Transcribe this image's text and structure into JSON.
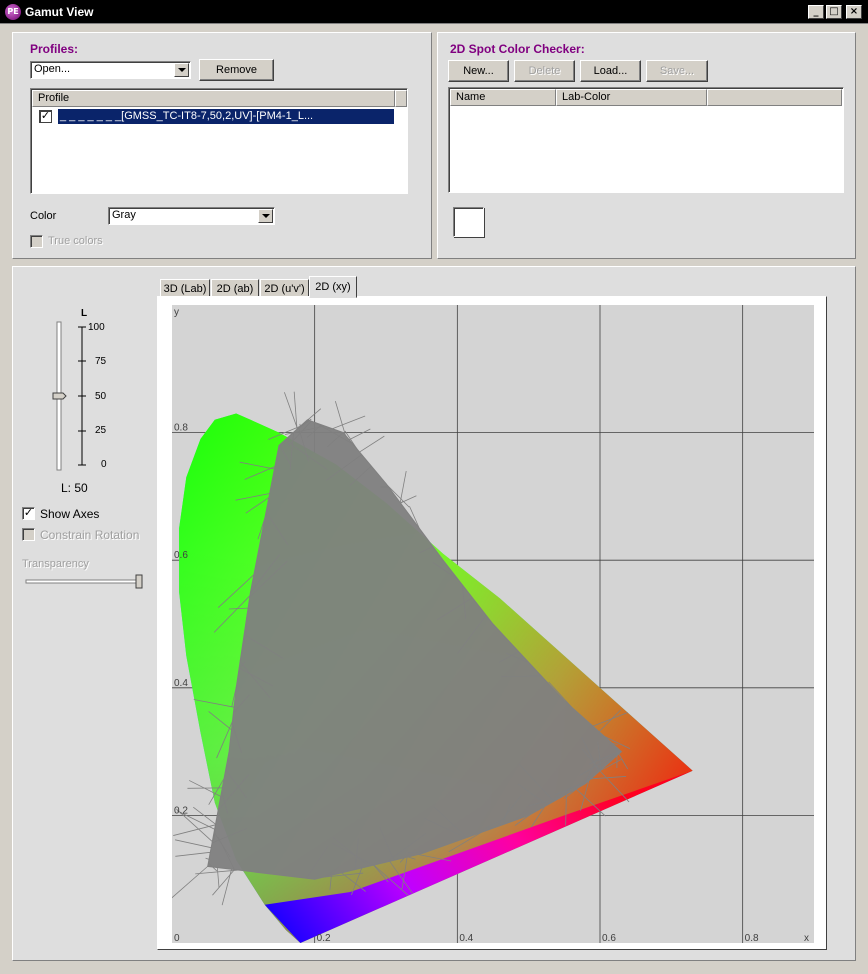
{
  "window": {
    "title": "Gamut View",
    "icon_text": "PE",
    "controls": {
      "minimize": "_",
      "maximize": "□",
      "close": "×"
    }
  },
  "profiles": {
    "title": "Profiles:",
    "open_combo": "Open...",
    "remove_label": "Remove",
    "list_header": "Profile",
    "items": [
      {
        "label": "_ _ _ _ _ _ _[GMSS_TC-IT8-7,50,2,UV]-[PM4-1_L...",
        "checked": true
      }
    ],
    "color_label": "Color",
    "color_value": "Gray",
    "true_colors_label": "True colors"
  },
  "spot_checker": {
    "title": "2D Spot Color Checker:",
    "new_label": "New...",
    "delete_label": "Delete",
    "load_label": "Load...",
    "save_label": "Save...",
    "columns": [
      "Name",
      "Lab-Color"
    ],
    "swatch_color": "#ffffff"
  },
  "controls": {
    "l_axis_label": "L",
    "l_ticks": [
      "100",
      "75",
      "50",
      "25",
      "0"
    ],
    "l_value": 50,
    "l_readout": "L: 50",
    "show_axes_label": "Show Axes",
    "show_axes_checked": true,
    "constrain_rotation_label": "Constrain Rotation",
    "transparency_label": "Transparency",
    "transparency_value": 1.0
  },
  "tabs": [
    {
      "label": "3D (Lab)",
      "active": false
    },
    {
      "label": "2D (ab)",
      "active": false
    },
    {
      "label": "2D (u'v')",
      "active": false
    },
    {
      "label": "2D (xy)",
      "active": true
    }
  ],
  "chart_data": {
    "type": "scatter",
    "title": "",
    "xlabel": "x",
    "ylabel": "y",
    "xlim": [
      0,
      0.9
    ],
    "ylim": [
      0,
      1.0
    ],
    "grid": true,
    "x_ticks": [
      "0",
      "0.2",
      "0.4",
      "0.6",
      "0.8"
    ],
    "y_ticks": [
      "0.2",
      "0.4",
      "0.6",
      "0.8"
    ],
    "origin_label": "0",
    "background_color": "#d4d4d4",
    "grid_color": "#404040",
    "gamut_color": "#808080",
    "spectral_locus": [
      [
        0.18,
        0.0
      ],
      [
        0.16,
        0.02
      ],
      [
        0.13,
        0.06
      ],
      [
        0.09,
        0.13
      ],
      [
        0.06,
        0.22
      ],
      [
        0.04,
        0.33
      ],
      [
        0.02,
        0.45
      ],
      [
        0.01,
        0.55
      ],
      [
        0.01,
        0.65
      ],
      [
        0.02,
        0.73
      ],
      [
        0.04,
        0.79
      ],
      [
        0.06,
        0.82
      ],
      [
        0.09,
        0.83
      ],
      [
        0.11,
        0.82
      ],
      [
        0.15,
        0.8
      ],
      [
        0.23,
        0.75
      ],
      [
        0.3,
        0.69
      ],
      [
        0.38,
        0.61
      ],
      [
        0.46,
        0.54
      ],
      [
        0.54,
        0.46
      ],
      [
        0.62,
        0.38
      ],
      [
        0.73,
        0.27
      ],
      [
        0.18,
        0.0
      ]
    ],
    "gamut_outline": [
      [
        0.19,
        0.82
      ],
      [
        0.15,
        0.78
      ],
      [
        0.11,
        0.55
      ],
      [
        0.09,
        0.4
      ],
      [
        0.08,
        0.3
      ],
      [
        0.06,
        0.18
      ],
      [
        0.05,
        0.12
      ],
      [
        0.2,
        0.1
      ],
      [
        0.35,
        0.14
      ],
      [
        0.5,
        0.2
      ],
      [
        0.58,
        0.25
      ],
      [
        0.63,
        0.3
      ],
      [
        0.55,
        0.38
      ],
      [
        0.45,
        0.5
      ],
      [
        0.38,
        0.6
      ],
      [
        0.3,
        0.72
      ],
      [
        0.24,
        0.8
      ],
      [
        0.19,
        0.82
      ]
    ]
  }
}
